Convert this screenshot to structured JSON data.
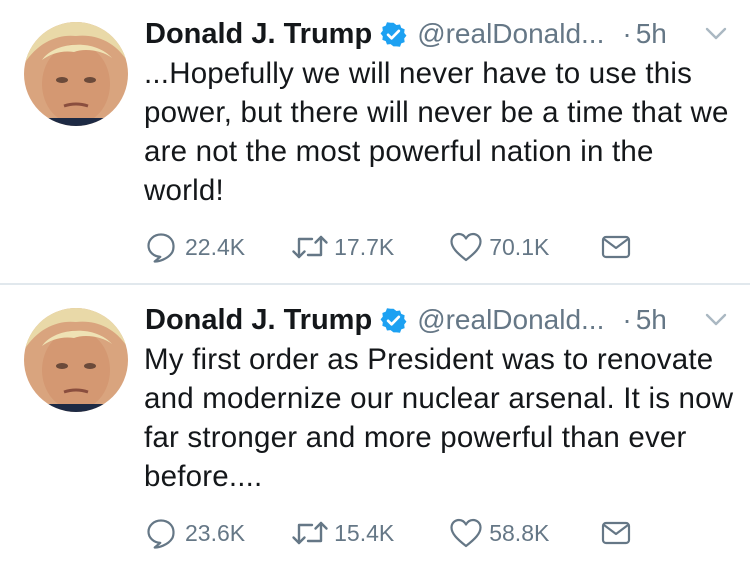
{
  "tweets": [
    {
      "name": "Donald J. Trump",
      "handle": "@realDonald...",
      "dot": "·",
      "time": "5h",
      "text": "...Hopefully we will never have to use this power, but there will never be a time that we are not the most powerful nation in the world!",
      "replies": "22.4K",
      "retweets": "17.7K",
      "likes": "70.1K"
    },
    {
      "name": "Donald J. Trump",
      "handle": "@realDonald...",
      "dot": "·",
      "time": "5h",
      "text": "My first order as President was to renovate and modernize our nuclear arsenal. It is now far stronger and more powerful than ever before....",
      "replies": "23.6K",
      "retweets": "15.4K",
      "likes": "58.8K"
    }
  ],
  "colors": {
    "verified": "#1da1f2",
    "muted": "#657786",
    "text": "#14171a",
    "divider": "#e1e8ed"
  },
  "icons": [
    "verified-badge-icon",
    "chevron-down-icon",
    "reply-icon",
    "retweet-icon",
    "heart-icon",
    "direct-message-icon"
  ]
}
